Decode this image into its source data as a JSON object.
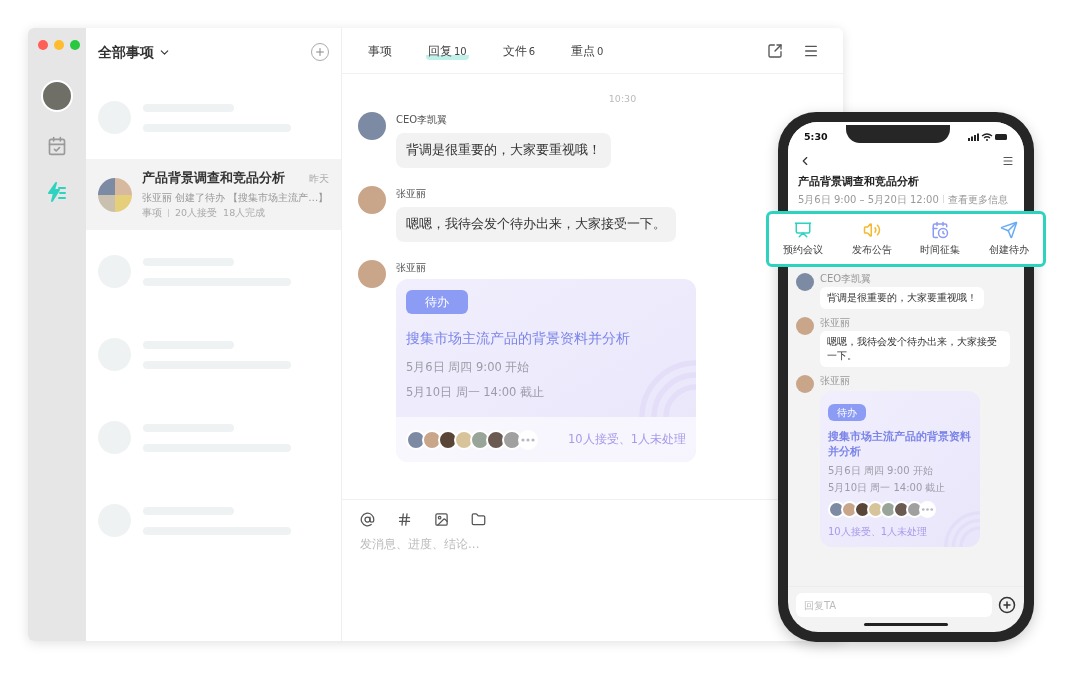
{
  "list": {
    "title": "全部事项",
    "items": [
      {
        "kind": "placeholder",
        "selected": false
      },
      {
        "kind": "thread",
        "selected": true,
        "title": "产品背景调查和竞品分析",
        "time": "昨天",
        "preview": "张亚丽 创建了待办 【搜集市场主流产…】",
        "meta": [
          "事项",
          "20人接受",
          "18人完成"
        ]
      },
      {
        "kind": "placeholder",
        "selected": false
      },
      {
        "kind": "placeholder",
        "selected": false
      },
      {
        "kind": "placeholder",
        "selected": false
      },
      {
        "kind": "placeholder",
        "selected": false
      }
    ]
  },
  "tabs": [
    {
      "label": "事项",
      "selected": false
    },
    {
      "label": "回复",
      "count": "10",
      "selected": true
    },
    {
      "label": "文件",
      "count": "6",
      "selected": false
    },
    {
      "label": "重点",
      "count": "0",
      "selected": false
    }
  ],
  "chat": {
    "time": "10:30",
    "messages": [
      {
        "kind": "text",
        "sender": "CEO李凯翼",
        "text": "背调是很重要的，大家要重视哦！"
      },
      {
        "kind": "text",
        "sender": "张亚丽",
        "text": "嗯嗯，我待会发个待办出来，大家接受一下。"
      },
      {
        "kind": "task",
        "sender": "张亚丽",
        "tag": "待办",
        "title": "搜集市场主流产品的背景资料并分析",
        "start": "5月6日 周四 9:00 开始",
        "end": "5月10日 周一 14:00 截止",
        "status": "10人接受、1人未处理"
      }
    ]
  },
  "composer": {
    "placeholder": "发消息、进度、结论..."
  },
  "phone": {
    "time": "5:30",
    "title": "产品背景调查和竞品分析",
    "dates": "5月6日 9:00 – 5月20日 12:00",
    "more": "查看更多信息",
    "actions": [
      {
        "kind": "meeting",
        "label": "预约会议"
      },
      {
        "kind": "announce",
        "label": "发布公告"
      },
      {
        "kind": "poll",
        "label": "时间征集"
      },
      {
        "kind": "todo",
        "label": "创建待办"
      }
    ],
    "messages": [
      {
        "kind": "text",
        "sender": "CEO李凯翼",
        "text": "背调是很重要的，大家要重视哦！"
      },
      {
        "kind": "text",
        "sender": "张亚丽",
        "text": "嗯嗯，我待会发个待办出来，大家接受一下。"
      },
      {
        "kind": "task",
        "sender": "张亚丽",
        "tag": "待办",
        "title": "搜集市场主流产品的背景资料并分析",
        "start": "5月6日 周四 9:00 开始",
        "end": "5月10日 周一 14:00 截止",
        "status": "10人接受、1人未处理"
      }
    ],
    "reply": {
      "placeholder": "回复TA"
    }
  }
}
